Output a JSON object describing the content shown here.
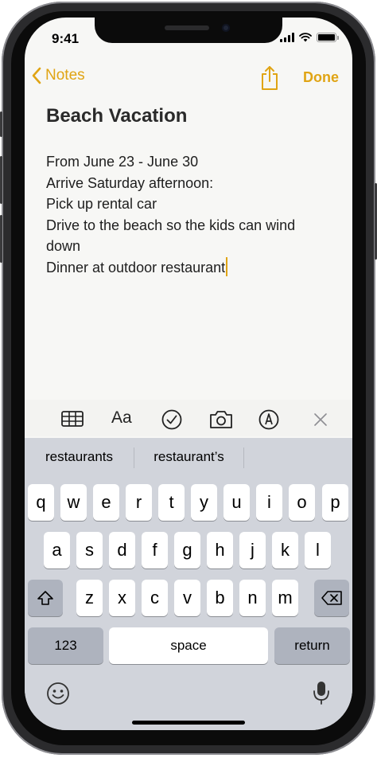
{
  "status_bar": {
    "time": "9:41"
  },
  "nav": {
    "back_label": "Notes",
    "done_label": "Done"
  },
  "note": {
    "title": "Beach Vacation",
    "lines": [
      "From June 23 - June 30",
      "Arrive Saturday afternoon:",
      "Pick up rental car",
      "Drive to the beach so the kids can wind",
      "down",
      "Dinner at outdoor restaurant"
    ]
  },
  "format_bar": {
    "text_style_label": "Aa"
  },
  "suggestions": [
    "restaurants",
    "restaurant’s",
    ""
  ],
  "keyboard": {
    "row1": [
      "q",
      "w",
      "e",
      "r",
      "t",
      "y",
      "u",
      "i",
      "o",
      "p"
    ],
    "row2": [
      "a",
      "s",
      "d",
      "f",
      "g",
      "h",
      "j",
      "k",
      "l"
    ],
    "row3": [
      "z",
      "x",
      "c",
      "v",
      "b",
      "n",
      "m"
    ],
    "numbers_label": "123",
    "space_label": "space",
    "return_label": "return"
  },
  "colors": {
    "accent": "#e0a414",
    "keyboard_bg": "#d1d4db"
  },
  "icons": {
    "back": "chevron-left-icon",
    "share": "share-icon",
    "table": "table-icon",
    "checklist": "checklist-icon",
    "camera": "camera-icon",
    "markup": "markup-pen-icon",
    "close": "close-icon",
    "shift": "shift-icon",
    "delete": "backspace-icon",
    "emoji": "emoji-icon",
    "mic": "microphone-icon"
  }
}
